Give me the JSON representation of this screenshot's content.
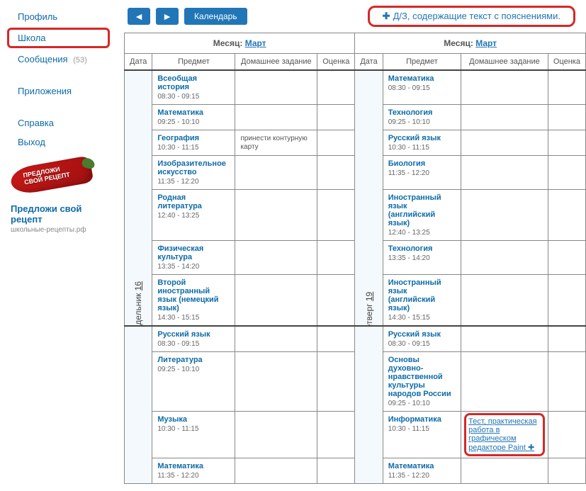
{
  "sidebar": {
    "items": [
      {
        "label": "Профиль"
      },
      {
        "label": "Школа"
      },
      {
        "label": "Сообщения",
        "count": "(53)"
      },
      {
        "label": "Приложения"
      },
      {
        "label": "Справка"
      },
      {
        "label": "Выход"
      }
    ],
    "pepper_line1": "ПРЕДЛОЖИ",
    "pepper_line2": "СВОЙ РЕЦЕПТ",
    "recipe_link": "Предложи свой рецепт",
    "recipe_sub": "школьные-рецепты.рф"
  },
  "topbar": {
    "calendar": "Календарь",
    "hint": "Д/З, содержащие текст с пояснениями."
  },
  "table": {
    "month_label": "Месяц:",
    "month": "Март",
    "headers": [
      "Дата",
      "Предмет",
      "Домашнее задание",
      "Оценка"
    ],
    "day1": {
      "name": "Понедельник",
      "num": "16"
    },
    "day2": {
      "name": "Четверг",
      "num": "19"
    },
    "left": [
      [
        {
          "s": "Всеобщая история",
          "t": "08:30 - 09:15"
        },
        {
          "s": "Математика",
          "t": "08:30 - 09:15"
        }
      ],
      [
        {
          "s": "Математика",
          "t": "09:25 - 10:10"
        },
        {
          "s": "Технология",
          "t": "09:25 - 10:10"
        }
      ],
      [
        {
          "s": "География",
          "t": "10:30 - 11:15",
          "hw": "принести контурную карту"
        },
        {
          "s": "Русский язык",
          "t": "10:30 - 11:15"
        }
      ],
      [
        {
          "s": "Изобразительное искусство",
          "t": "11:35 - 12:20"
        },
        {
          "s": "Биология",
          "t": "11:35 - 12:20"
        }
      ],
      [
        {
          "s": "Родная литература",
          "t": "12:40 - 13:25"
        },
        {
          "s": "Иностранный язык (английский язык)",
          "t": "12:40 - 13:25"
        }
      ],
      [
        {
          "s": "Физическая культура",
          "t": "13:35 - 14:20"
        },
        {
          "s": "Технология",
          "t": "13:35 - 14:20"
        }
      ],
      [
        {
          "s": "Второй иностранный язык (немецкий язык)",
          "t": "14:30 - 15:15"
        },
        {
          "s": "Иностранный язык (английский язык)",
          "t": "14:30 - 15:15"
        }
      ]
    ],
    "bottom": [
      [
        {
          "s": "Русский язык",
          "t": "08:30 - 09:15"
        },
        {
          "s": "Русский язык",
          "t": "08:30 - 09:15"
        }
      ],
      [
        {
          "s": "Литература",
          "t": "09:25 - 10:10"
        },
        {
          "s": "Основы духовно-нравственной культуры народов России",
          "t": "09:25 - 10:10"
        }
      ],
      [
        {
          "s": "Музыка",
          "t": "10:30 - 11:15"
        },
        {
          "s": "Информатика",
          "t": "10:30 - 11:15",
          "hw": "Тест, практическая работа в графическом редакторе Paint ✚",
          "hl": true
        }
      ],
      [
        {
          "s": "Математика",
          "t": "11:35 - 12:20"
        },
        {
          "s": "Математика",
          "t": "11:35 - 12:20"
        }
      ]
    ]
  }
}
